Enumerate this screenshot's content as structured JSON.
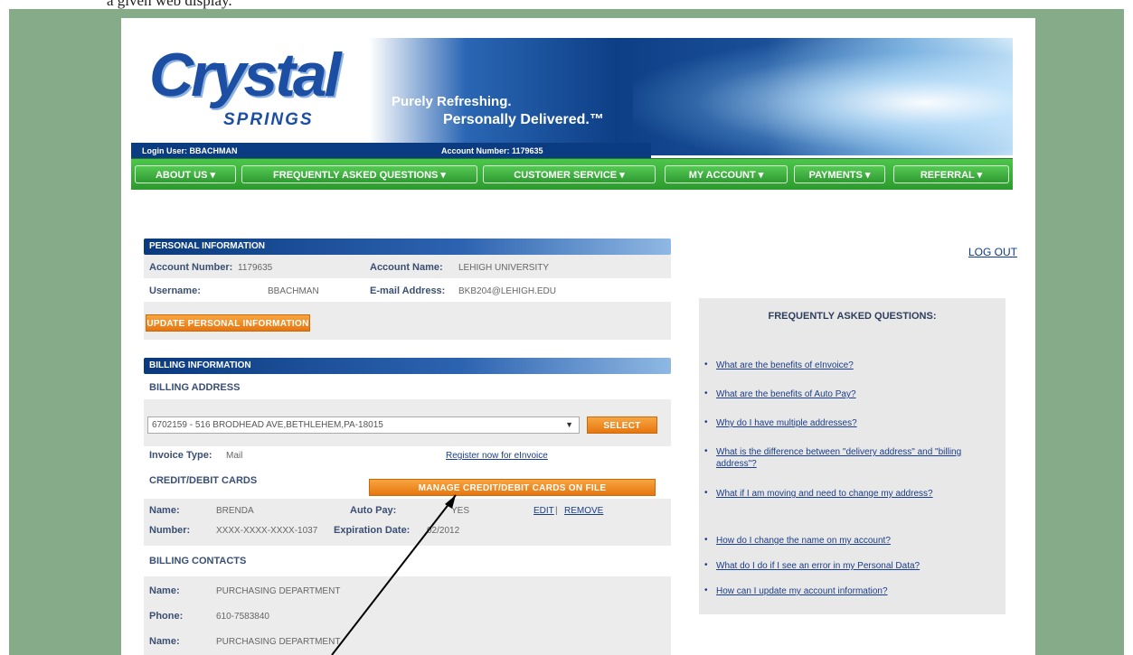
{
  "caption": "a given web display.",
  "header": {
    "logo": "Crystal",
    "logo_sub": "SPRINGS",
    "tagline1": "Purely Refreshing.",
    "tagline2": "Personally Delivered.™",
    "login_user": "Login User:  BBACHMAN",
    "account_number": "Account Number:  1179635"
  },
  "nav": [
    "ABOUT US ▾",
    "FREQUENTLY ASKED QUESTIONS ▾",
    "CUSTOMER SERVICE ▾",
    "MY ACCOUNT ▾",
    "PAYMENTS ▾",
    "REFERRAL ▾"
  ],
  "logout": "LOG OUT",
  "personal": {
    "title": "PERSONAL INFORMATION",
    "account_number_label": "Account Number:",
    "account_number": "1179635",
    "account_name_label": "Account Name:",
    "account_name": "LEHIGH UNIVERSITY",
    "username_label": "Username:",
    "username": "BBACHMAN",
    "email_label": "E-mail Address:",
    "email": "BKB204@LEHIGH.EDU",
    "update_button": "UPDATE PERSONAL INFORMATION"
  },
  "billing": {
    "title": "BILLING INFORMATION",
    "address_title": "BILLING ADDRESS",
    "address_selected": "6702159 - 516 BRODHEAD AVE,BETHLEHEM,PA-18015",
    "select_button": "SELECT",
    "invoice_label": "Invoice Type:",
    "invoice_value": "Mail",
    "einvoice_link": "Register now for eInvoice",
    "cards_title": "CREDIT/DEBIT CARDS",
    "manage_cards_button": "MANAGE CREDIT/DEBIT CARDS ON FILE",
    "name_label": "Name:",
    "name_value": "BRENDA",
    "autopay_label": "Auto Pay:",
    "autopay_value": "YES",
    "edit_link": "EDIT",
    "sep": "|",
    "remove_link": "REMOVE",
    "number_label": "Number:",
    "number_value": "XXXX-XXXX-XXXX-1037",
    "expiration_label": "Expiration Date:",
    "expiration_value": "02/2012",
    "contacts_title": "BILLING CONTACTS",
    "contacts": [
      {
        "label": "Name:",
        "value": "PURCHASING DEPARTMENT"
      },
      {
        "label": "Phone:",
        "value": "610-7583840"
      },
      {
        "label": "Name:",
        "value": "PURCHASING DEPARTMENT"
      }
    ]
  },
  "faq": {
    "title": "FREQUENTLY ASKED QUESTIONS:",
    "items": [
      "What are the benefits of eInvoice?",
      "What are the benefits of Auto Pay?",
      "Why do I have multiple addresses?",
      "What is the difference between \"delivery address\" and \"billing address\"?",
      "What if I am moving and need to change my address?",
      "How do I change the name on my account?",
      "What do I do if I see an error in my Personal Data?",
      "How can I update my account information?"
    ]
  },
  "colors": {
    "frame": "#85ab88",
    "nav_green": "#2c9a2e",
    "header_blue": "#0b3b80",
    "button_orange": "#e7760f"
  }
}
